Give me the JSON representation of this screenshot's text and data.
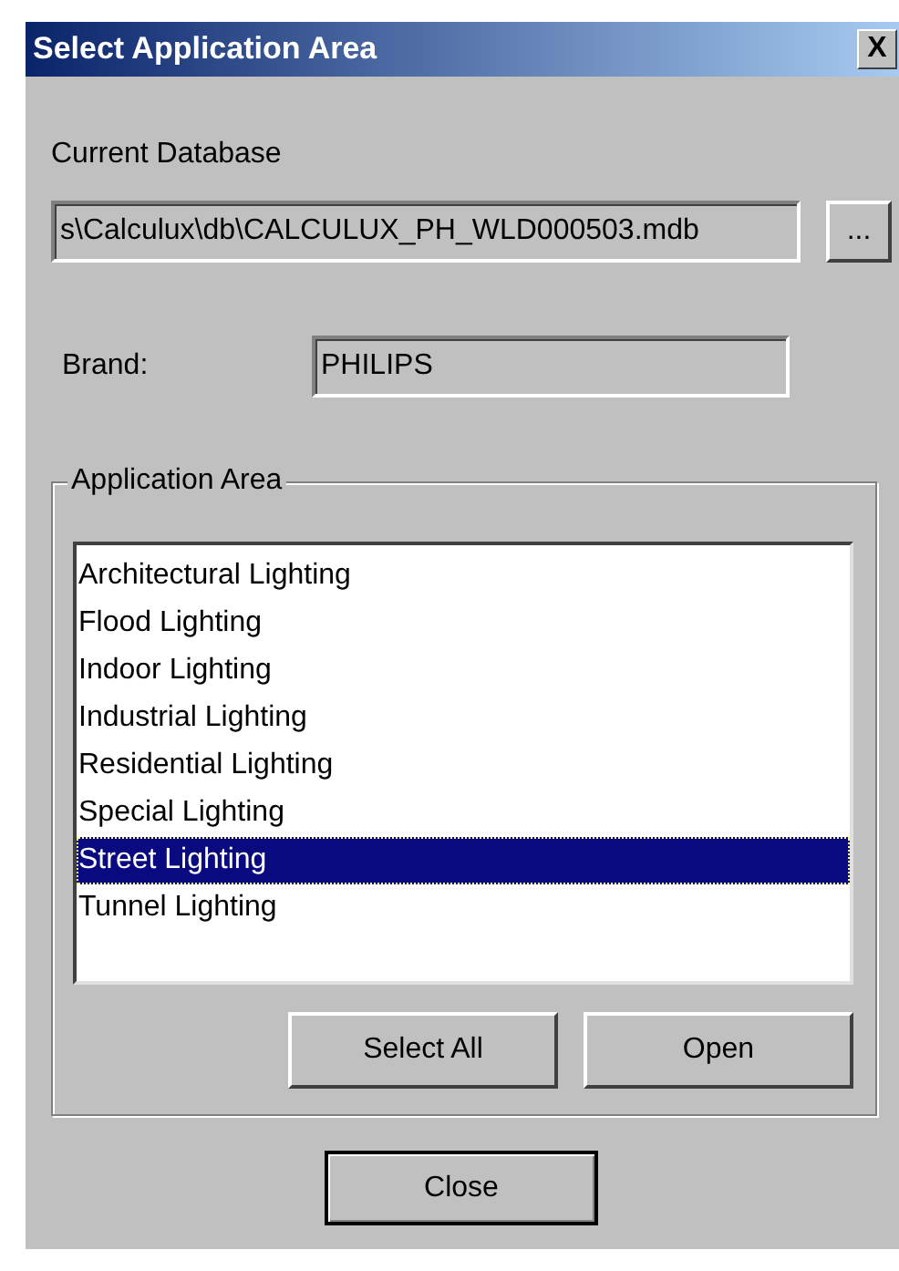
{
  "window": {
    "title": "Select Application Area",
    "close_symbol": "X"
  },
  "database": {
    "label": "Current Database",
    "value": "s\\Calculux\\db\\CALCULUX_PH_WLD000503.mdb",
    "browse_button": "..."
  },
  "brand": {
    "label": "Brand:",
    "value": "PHILIPS"
  },
  "application_area": {
    "legend": "Application Area",
    "items": [
      {
        "label": "Architectural Lighting",
        "selected": false
      },
      {
        "label": "Flood Lighting",
        "selected": false
      },
      {
        "label": "Indoor Lighting",
        "selected": false
      },
      {
        "label": "Industrial Lighting",
        "selected": false
      },
      {
        "label": "Residential Lighting",
        "selected": false
      },
      {
        "label": "Special Lighting",
        "selected": false
      },
      {
        "label": "Street Lighting",
        "selected": true
      },
      {
        "label": "Tunnel Lighting",
        "selected": false
      }
    ],
    "buttons": [
      "Select All",
      "Open"
    ]
  },
  "close_button": "Close"
}
